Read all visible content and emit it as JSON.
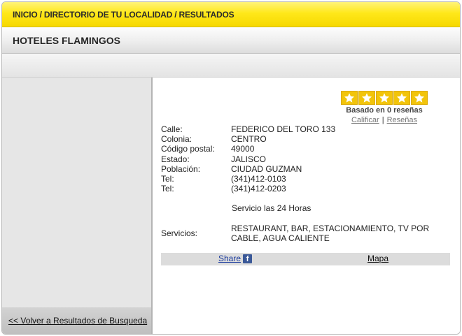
{
  "breadcrumb": {
    "text": "INICIO / DIRECTORIO DE TU LOCALIDAD / RESULTADOS"
  },
  "listing": {
    "title": "HOTELES FLAMINGOS"
  },
  "rating": {
    "stars_total": 5,
    "text": "Basado en 0 reseñas",
    "rate_link": "Calificar",
    "separator": "|",
    "reviews_link": "Reseñas"
  },
  "address": [
    {
      "label": "Calle:",
      "value": "FEDERICO DEL TORO 133"
    },
    {
      "label": "Colonia:",
      "value": "CENTRO"
    },
    {
      "label": "Código postal:",
      "value": "49000"
    },
    {
      "label": "Estado:",
      "value": "JALISCO"
    },
    {
      "label": "Población:",
      "value": "CIUDAD GUZMAN"
    },
    {
      "label": "Tel:",
      "value": "(341)412-0103"
    },
    {
      "label": "Tel:",
      "value": "(341)412-0203"
    }
  ],
  "service_hours": "Servicio las 24 Horas",
  "services": {
    "label": "Servicios:",
    "value": "RESTAURANT, BAR, ESTACIONAMIENTO, TV POR CABLE, AGUA CALIENTE"
  },
  "actions": {
    "share_label": "Share",
    "share_icon": "facebook-icon",
    "map_label": "Mapa"
  },
  "sidebar": {
    "back_link": "<< Volver a Resultados de Busqueda"
  },
  "colors": {
    "breadcrumb_bg": "#ffe81a",
    "star": "#f2c40a",
    "link": "#1a3a9c"
  }
}
